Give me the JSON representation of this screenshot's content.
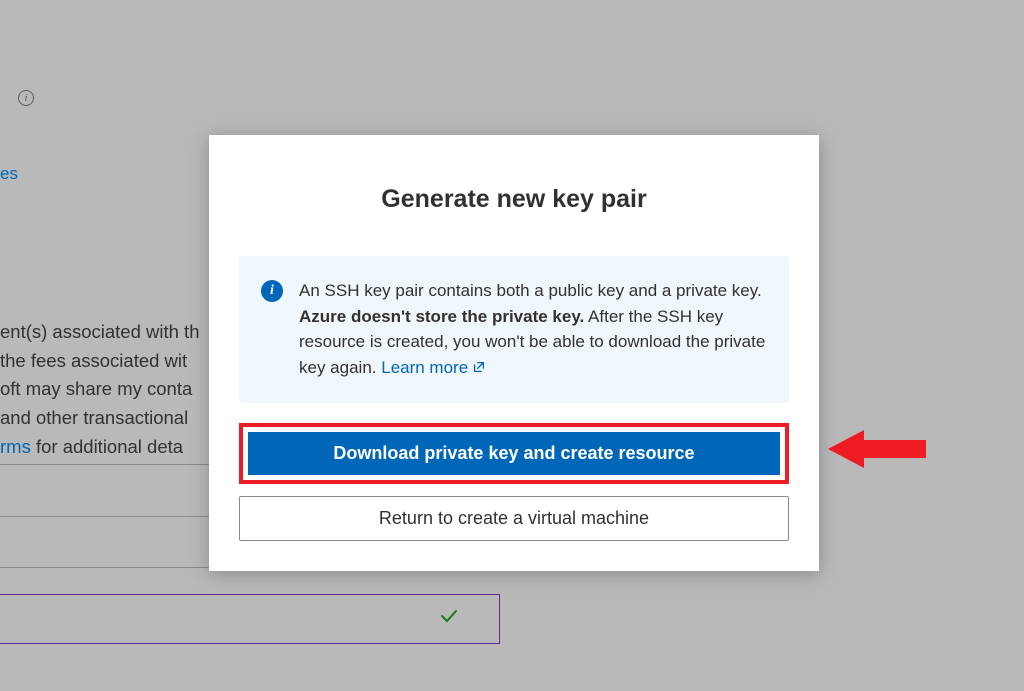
{
  "background": {
    "link_fragment": "es",
    "text_lines": [
      "ent(s) associated with th",
      " the fees associated wit",
      "oft may share my conta",
      "and other transactional"
    ],
    "terms_link_text": "rms",
    "terms_after": " for additional deta"
  },
  "modal": {
    "title": "Generate new key pair",
    "info": {
      "text_before_bold": "An SSH key pair contains both a public key and a private key. ",
      "bold_text": "Azure doesn't store the private key.",
      "text_after_bold": " After the SSH key resource is created, you won't be able to download the private key again. ",
      "learn_more": "Learn more"
    },
    "primary_button": "Download private key and create resource",
    "secondary_button": "Return to create a virtual machine"
  }
}
